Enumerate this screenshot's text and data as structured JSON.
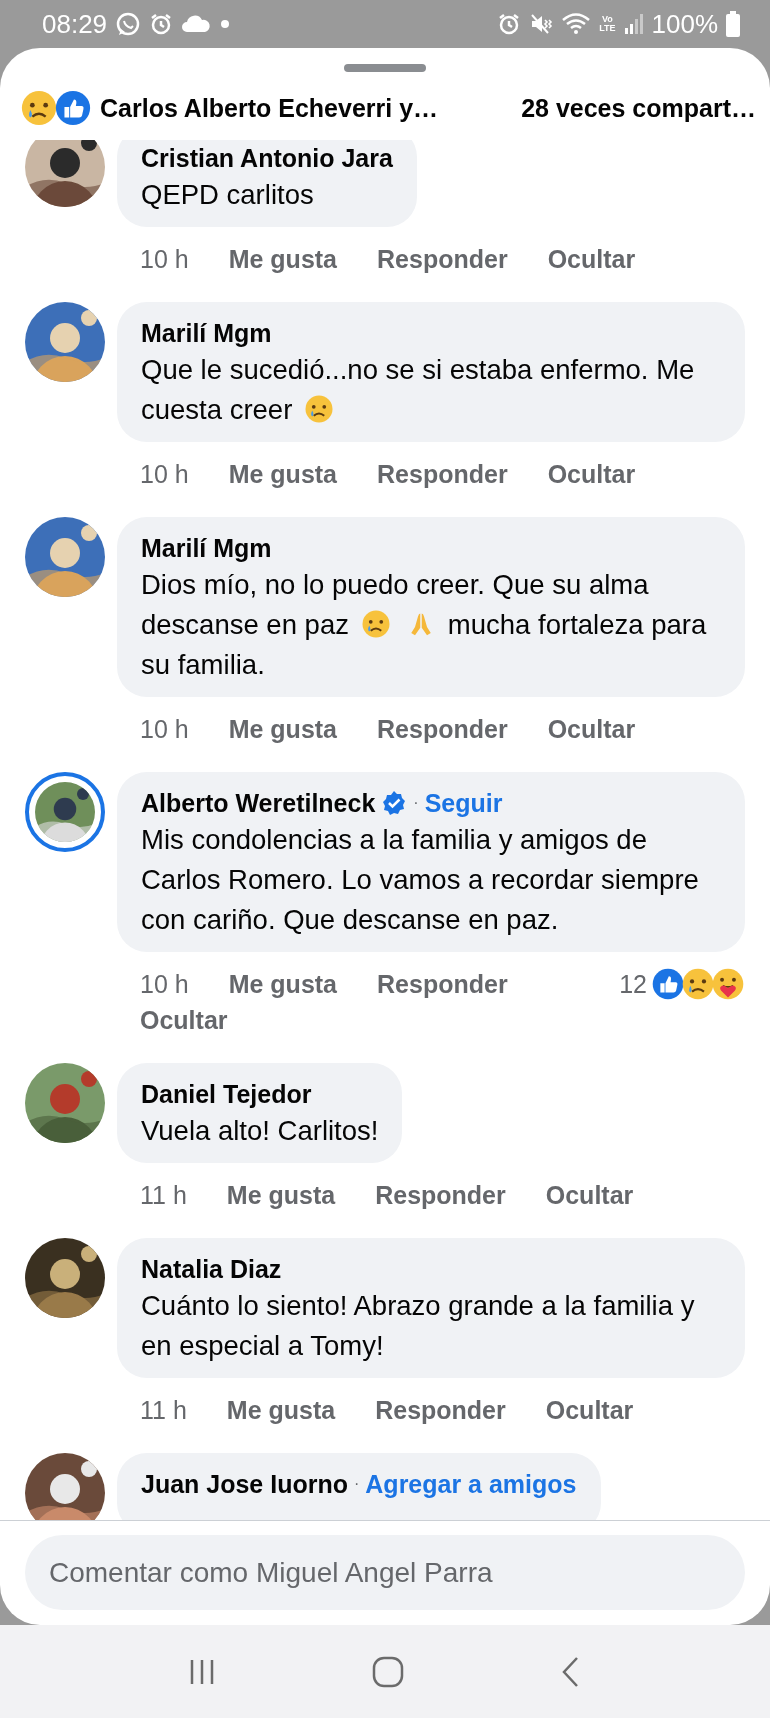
{
  "status_bar": {
    "time": "08:29",
    "network": [
      "Vo",
      "LTE"
    ],
    "battery": "100%"
  },
  "header": {
    "reactors": "Carlos Alberto Echeverri y…",
    "shares": "28 veces compart…"
  },
  "comments": [
    {
      "author": "Cristian Antonio Jara",
      "verified": false,
      "ring": false,
      "body": [
        {
          "kind": "text",
          "text": "QEPD carlitos"
        }
      ],
      "time": "10 h",
      "actions": [
        "Me gusta",
        "Responder",
        "Ocultar"
      ]
    },
    {
      "author": "Marilí Mgm",
      "verified": false,
      "ring": false,
      "body": [
        {
          "kind": "text",
          "text": "Que le sucedió...no se si estaba enfermo.  Me cuesta creer"
        },
        {
          "kind": "sad"
        }
      ],
      "time": "10 h",
      "actions": [
        "Me gusta",
        "Responder",
        "Ocultar"
      ]
    },
    {
      "author": "Marilí Mgm",
      "verified": false,
      "ring": false,
      "body": [
        {
          "kind": "text",
          "text": "Dios mío, no lo puedo creer.  Que su alma descanse en paz"
        },
        {
          "kind": "sad"
        },
        {
          "kind": "pray"
        },
        {
          "kind": "text",
          "text": "mucha fortaleza para su familia."
        }
      ],
      "time": "10 h",
      "actions": [
        "Me gusta",
        "Responder",
        "Ocultar"
      ]
    },
    {
      "author": "Alberto Weretilneck",
      "verified": true,
      "ring": true,
      "separator": "·",
      "link": "Seguir",
      "body": [
        {
          "kind": "text",
          "text": "Mis condolencias a la familia y amigos de Carlos Romero. Lo vamos a recordar siempre con cariño. Que descanse en paz."
        }
      ],
      "time": "10 h",
      "actions": [
        "Me gusta",
        "Responder",
        "Ocultar"
      ],
      "reaction_count": "12",
      "reactions": [
        {
          "kind": "like"
        },
        {
          "kind": "sad"
        },
        {
          "kind": "care"
        }
      ]
    },
    {
      "author": "Daniel Tejedor",
      "verified": false,
      "ring": false,
      "body": [
        {
          "kind": "text",
          "text": "Vuela alto! Carlitos!"
        }
      ],
      "time": "11 h",
      "actions": [
        "Me gusta",
        "Responder",
        "Ocultar"
      ]
    },
    {
      "author": "Natalia Diaz",
      "verified": false,
      "ring": false,
      "body": [
        {
          "kind": "text",
          "text": "Cuánto lo siento! Abrazo grande a la familia y en especial a Tomy!"
        }
      ],
      "time": "11 h",
      "actions": [
        "Me gusta",
        "Responder",
        "Ocultar"
      ]
    },
    {
      "author": "Juan Jose Iuorno",
      "verified": false,
      "ring": false,
      "separator": "·",
      "link": "Agregar a amigos"
    }
  ],
  "composer": {
    "placeholder": "Comentar como Miguel Angel Parra"
  }
}
